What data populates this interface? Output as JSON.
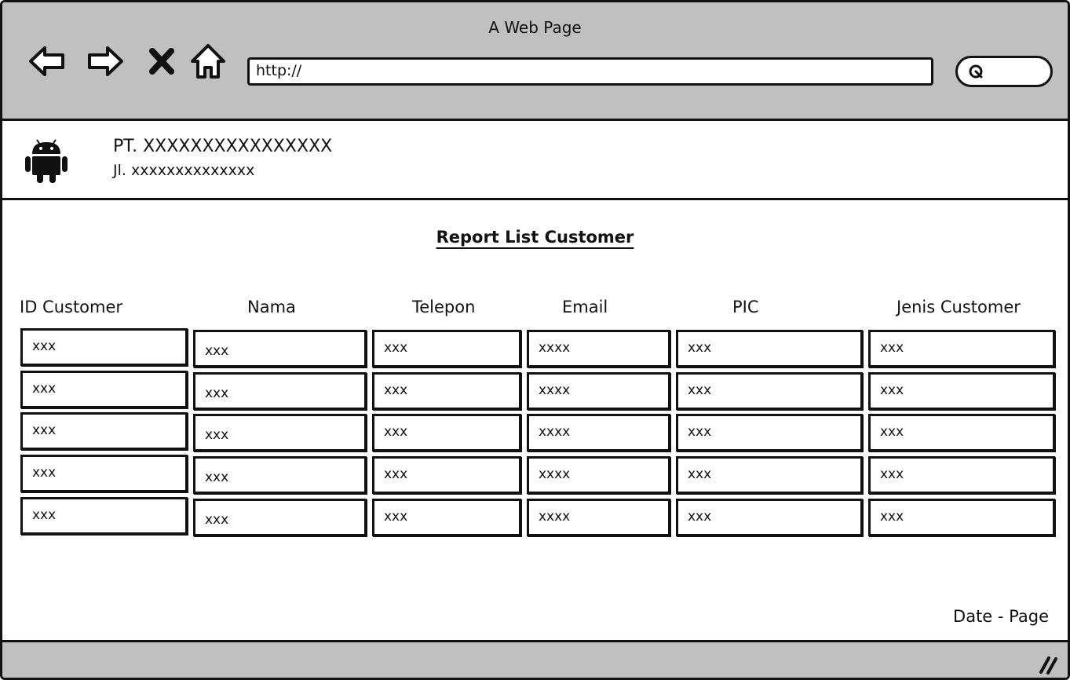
{
  "window": {
    "title": "A Web Page",
    "url": "http://"
  },
  "toolbar": {
    "icons": [
      "back-arrow-icon",
      "forward-arrow-icon",
      "close-x-icon",
      "home-icon",
      "search-icon"
    ]
  },
  "company": {
    "logo_icon": "android-icon",
    "name": "PT. XXXXXXXXXXXXXXXX",
    "address": "Jl. xxxxxxxxxxxxxx"
  },
  "report": {
    "title": "Report List Customer",
    "columns": [
      "ID Customer",
      "Nama",
      "Telepon",
      "Email",
      "PIC",
      "Jenis Customer"
    ],
    "rows": [
      [
        "xxx",
        "xxx",
        "xxx",
        "xxxx",
        "xxx",
        "xxx"
      ],
      [
        "xxx",
        "xxx",
        "xxx",
        "xxxx",
        "xxx",
        "xxx"
      ],
      [
        "xxx",
        "xxx",
        "xxx",
        "xxxx",
        "xxx",
        "xxx"
      ],
      [
        "xxx",
        "xxx",
        "xxx",
        "xxxx",
        "xxx",
        "xxx"
      ],
      [
        "xxx",
        "xxx",
        "xxx",
        "xxxx",
        "xxx",
        "xxx"
      ]
    ]
  },
  "footer": {
    "text": "Date - Page"
  },
  "status_bar": {
    "icon": "resize-grip-icon"
  }
}
